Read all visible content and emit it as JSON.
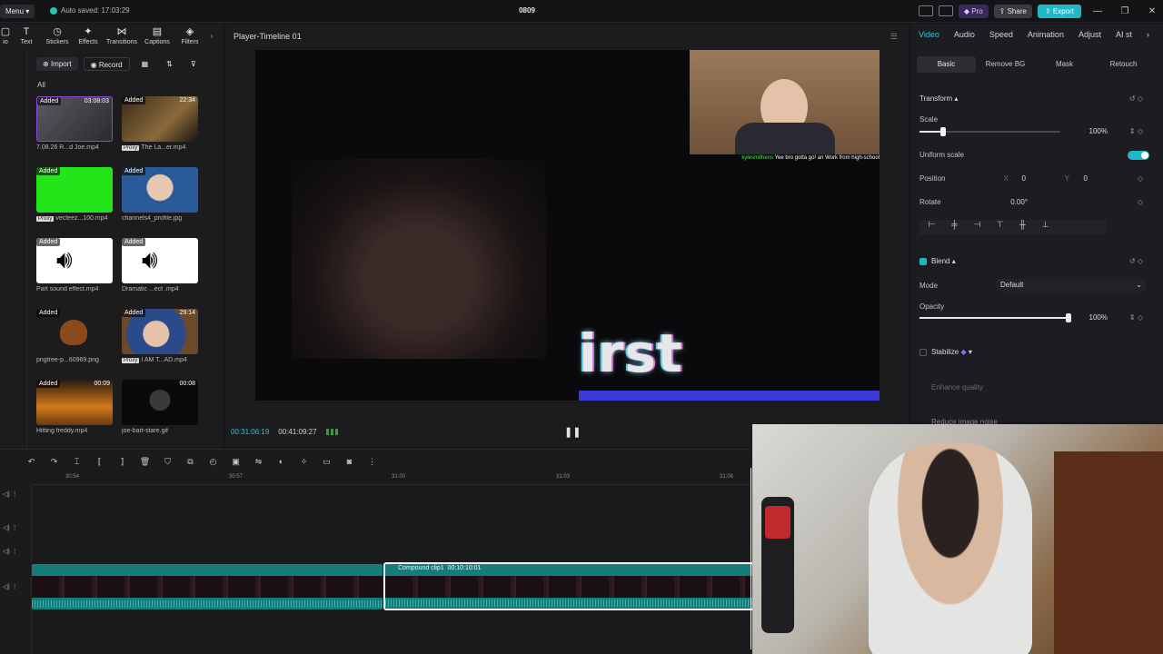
{
  "titlebar": {
    "menu_label": "Menu",
    "autosave_text": "Auto saved: 17:03:29",
    "project_title": "0809",
    "pro_label": "Pro",
    "share_label": "Share",
    "export_label": "Export"
  },
  "tools": [
    {
      "label": "Text",
      "icon": "text-icon"
    },
    {
      "label": "Stickers",
      "icon": "stickers-icon"
    },
    {
      "label": "Effects",
      "icon": "effects-icon"
    },
    {
      "label": "Transitions",
      "icon": "transitions-icon"
    },
    {
      "label": "Captions",
      "icon": "captions-icon"
    },
    {
      "label": "Filters",
      "icon": "filters-icon"
    }
  ],
  "media": {
    "import_label": "Import",
    "record_label": "Record",
    "filter_all": "All",
    "items": [
      {
        "added": "Added",
        "duration": "03:08:03",
        "name": "7.08.26 R...d Joe.mp4",
        "proxy": ""
      },
      {
        "added": "Added",
        "duration": "22:34",
        "name": "The La...er.mp4",
        "proxy": "Proxy"
      },
      {
        "added": "Added",
        "duration": "",
        "name": "vecteez...100.mp4",
        "proxy": "Proxy"
      },
      {
        "added": "Added",
        "duration": "",
        "name": "channels4_profile.jpg",
        "proxy": ""
      },
      {
        "added": "Added",
        "duration": "",
        "name": "Part sound effect.mp4",
        "proxy": ""
      },
      {
        "added": "Added",
        "duration": "",
        "name": "Dramatic ...ect .mp4",
        "proxy": ""
      },
      {
        "added": "Added",
        "duration": "",
        "name": "pngtree-p...60969.png",
        "proxy": ""
      },
      {
        "added": "Added",
        "duration": "29:14",
        "name": "I AM T...AD.mp4",
        "proxy": "Proxy"
      },
      {
        "added": "Added",
        "duration": "00:09",
        "name": "Hitting freddy.mp4",
        "proxy": ""
      },
      {
        "added": "",
        "duration": "00:08",
        "name": "joe-bart-stare.gif",
        "proxy": ""
      }
    ]
  },
  "player": {
    "title": "Player-Timeline 01",
    "overlay_text": "irst stream",
    "chat_user": "kylesmithens",
    "chat_text": "Yee bro gotta go! an Work from high-school",
    "current_time": "00:31:06:19",
    "total_time": "00:41:09:27"
  },
  "inspector": {
    "tabs": [
      "Video",
      "Audio",
      "Speed",
      "Animation",
      "Adjust",
      "AI st"
    ],
    "sub_tabs": [
      "Basic",
      "Remove BG",
      "Mask",
      "Retouch"
    ],
    "transform_label": "Transform",
    "scale_label": "Scale",
    "scale_value": "100%",
    "scale_level": 0.17,
    "uniform_label": "Uniform scale",
    "position_label": "Position",
    "pos_x_label": "X",
    "pos_x": "0",
    "pos_y_label": "Y",
    "pos_y": "0",
    "rotate_label": "Rotate",
    "rotate_value": "0.00°",
    "blend_label": "Blend",
    "mode_label": "Mode",
    "mode_value": "Default",
    "opacity_label": "Opacity",
    "opacity_value": "100%",
    "opacity_level": 1.0,
    "stabilize_label": "Stabilize",
    "enhance_label": "Enhance quality",
    "reduce_label": "Reduce image noise"
  },
  "timeline": {
    "ruler": [
      "30:54",
      "30:57",
      "31:00",
      "31:03",
      "31:06"
    ],
    "compound_label": "Compound clip1",
    "compound_duration": "00:10:10:01"
  },
  "colors": {
    "accent": "#1fb8c9",
    "clip": "#147d7a",
    "pro": "#3a2a5c"
  }
}
